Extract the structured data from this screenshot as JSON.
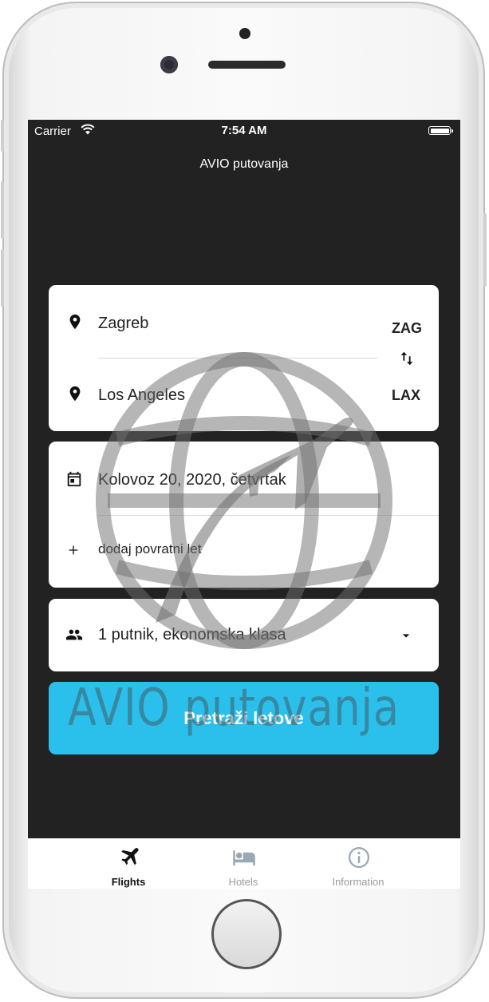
{
  "status_bar": {
    "carrier": "Carrier",
    "time": "7:54 AM"
  },
  "app": {
    "title": "AVIO putovanja"
  },
  "route": {
    "origin_city": "Zagreb",
    "origin_code": "ZAG",
    "destination_city": "Los Angeles",
    "destination_code": "LAX"
  },
  "dates": {
    "departure": "Kolovoz 20, 2020, četvrtak",
    "add_return": "dodaj povratni let"
  },
  "passengers": {
    "summary": "1 putnik, ekonomska klasa"
  },
  "search_button": {
    "label": "Pretraži letove"
  },
  "watermark": {
    "text": "AVIO putovanja"
  },
  "tabs": [
    {
      "label": "Flights",
      "icon": "airplane-icon",
      "active": true
    },
    {
      "label": "Hotels",
      "icon": "hotel-bed-icon",
      "active": false
    },
    {
      "label": "Information",
      "icon": "info-icon",
      "active": false
    }
  ],
  "colors": {
    "screen_background": "#222222",
    "accent": "#2bbfec",
    "card": "#ffffff",
    "tab_active": "#111111",
    "tab_inactive": "#9a9a9a"
  }
}
